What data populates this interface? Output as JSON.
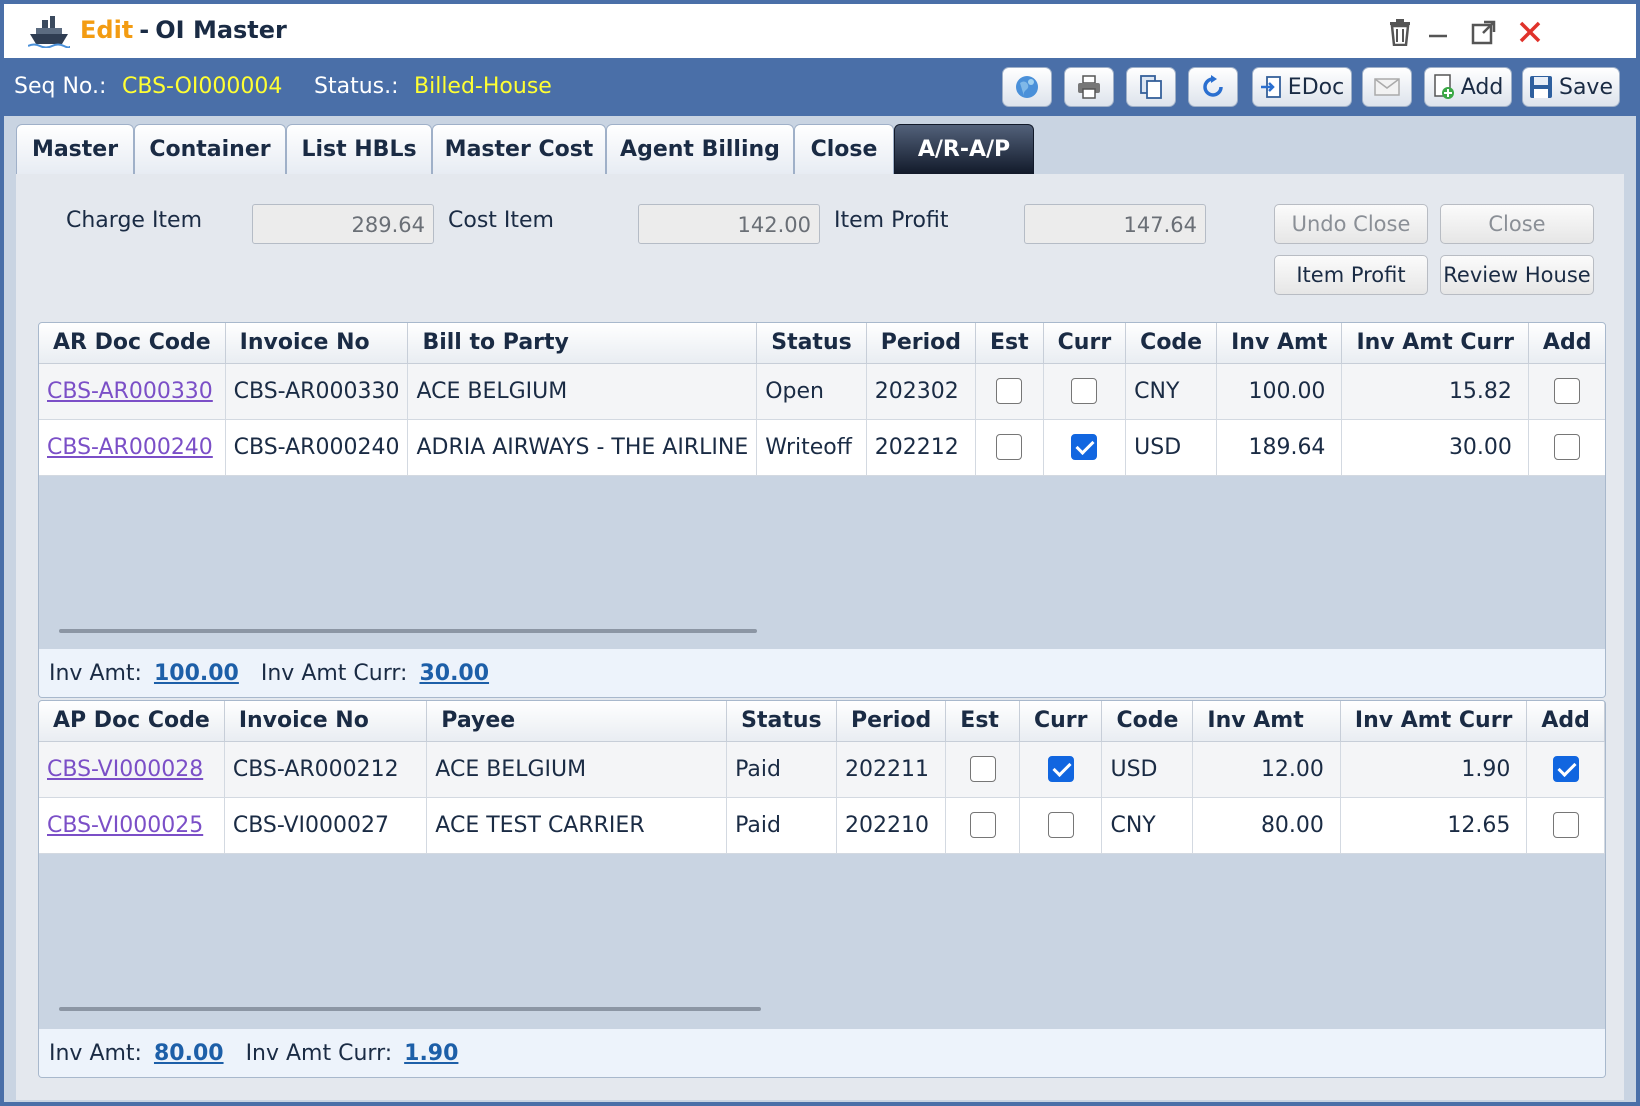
{
  "window": {
    "title_mode": "Edit",
    "title_sep": "-",
    "title_main": "OI Master"
  },
  "header": {
    "seq_label": "Seq No.:",
    "seq_value": "CBS-OI000004",
    "status_label": "Status.:",
    "status_value": "Billed-House",
    "buttons": {
      "edoc": "EDoc",
      "add": "Add",
      "save": "Save"
    }
  },
  "tabs": [
    "Master",
    "Container",
    "List HBLs",
    "Master Cost",
    "Agent Billing",
    "Close",
    "A/R-A/P"
  ],
  "summary": {
    "charge_label": "Charge Item",
    "charge_value": "289.64",
    "cost_label": "Cost Item",
    "cost_value": "142.00",
    "profit_label": "Item Profit",
    "profit_value": "147.64",
    "undo_close": "Undo Close",
    "close": "Close",
    "item_profit_btn": "Item Profit",
    "review_house": "Review House"
  },
  "ar": {
    "headers": [
      "AR Doc Code",
      "Invoice No",
      "Bill to Party",
      "Status",
      "Period",
      "Est",
      "Curr",
      "Code",
      "Inv Amt",
      "Inv Amt Curr",
      "Add"
    ],
    "rows": [
      {
        "doc": "CBS-AR000330",
        "invoice": "CBS-AR000330",
        "party": "ACE BELGIUM",
        "status": "Open",
        "period": "202302",
        "est": false,
        "curr": false,
        "code": "CNY",
        "inv_amt": "100.00",
        "inv_amt_curr": "15.82",
        "add": false
      },
      {
        "doc": "CBS-AR000240",
        "invoice": "CBS-AR000240",
        "party": "ADRIA AIRWAYS - THE AIRLINE",
        "status": "Writeoff",
        "period": "202212",
        "est": false,
        "curr": true,
        "code": "USD",
        "inv_amt": "189.64",
        "inv_amt_curr": "30.00",
        "add": false
      }
    ],
    "footer": {
      "inv_amt_label": "Inv Amt:",
      "inv_amt": "100.00",
      "inv_amt_curr_label": "Inv Amt Curr:",
      "inv_amt_curr": "30.00"
    }
  },
  "ap": {
    "headers": [
      "AP Doc Code",
      "Invoice No",
      "Payee",
      "Status",
      "Period",
      "Est",
      "Curr",
      "Code",
      "Inv Amt",
      "Inv Amt Curr",
      "Add"
    ],
    "rows": [
      {
        "doc": "CBS-VI000028",
        "invoice": "CBS-AR000212",
        "party": "ACE BELGIUM",
        "status": "Paid",
        "period": "202211",
        "est": false,
        "curr": true,
        "code": "USD",
        "inv_amt": "12.00",
        "inv_amt_curr": "1.90",
        "add": true
      },
      {
        "doc": "CBS-VI000025",
        "invoice": "CBS-VI000027",
        "party": "ACE TEST CARRIER",
        "status": "Paid",
        "period": "202210",
        "est": false,
        "curr": false,
        "code": "CNY",
        "inv_amt": "80.00",
        "inv_amt_curr": "12.65",
        "add": false
      }
    ],
    "footer": {
      "inv_amt_label": "Inv Amt:",
      "inv_amt": "80.00",
      "inv_amt_curr_label": "Inv Amt Curr:",
      "inv_amt_curr": "1.90"
    }
  },
  "colors": {
    "header_blue": "#4a6fa8",
    "title_accent": "#f39c12",
    "yellow_value": "#ffff33",
    "link_purple": "#7b4fc7",
    "checkbox_blue": "#1166e0"
  },
  "icons": [
    "ship-icon",
    "trash-icon",
    "minimize-icon",
    "maximize-icon",
    "close-icon",
    "globe-icon",
    "print-icon",
    "copy-icon",
    "refresh-icon",
    "edoc-icon",
    "mail-icon",
    "add-doc-icon",
    "save-icon"
  ]
}
